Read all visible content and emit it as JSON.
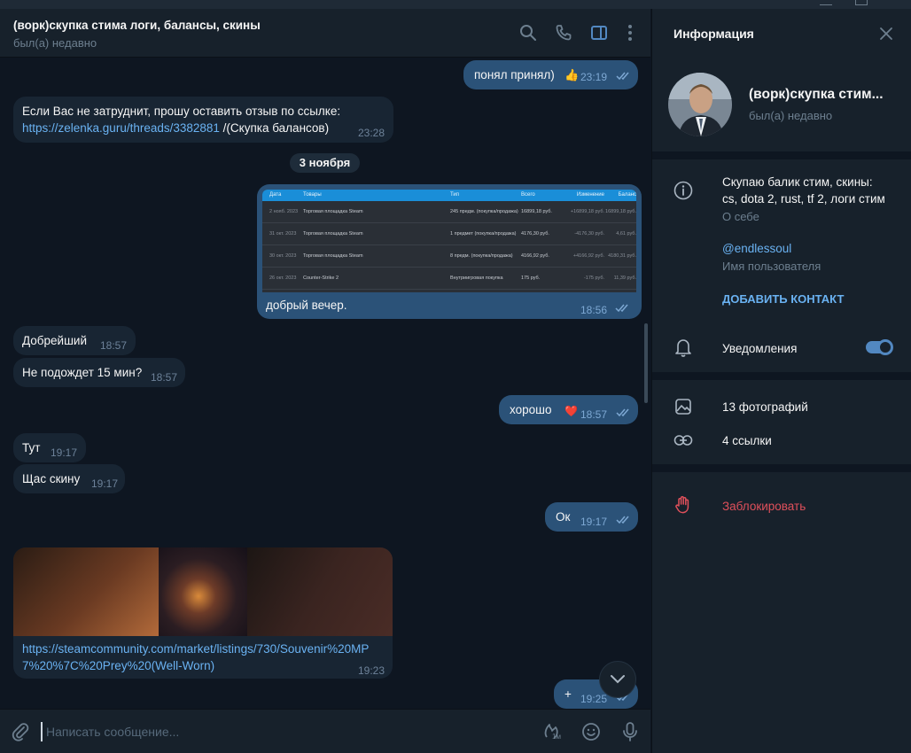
{
  "header": {
    "title": "(ворк)скупка стима логи, балансы, скины",
    "status": "был(а) недавно"
  },
  "messages": {
    "m1": {
      "text": "понял принял)",
      "reaction": "👍",
      "time": "23:19"
    },
    "m2": {
      "text_line1": "Если Вас не затруднит, прошу оставить отзыв по ссылке:",
      "link": "https://zelenka.guru/threads/3382881",
      "text_after_link": " /(Скупка балансов)",
      "time": "23:28"
    },
    "date_separator": "3 ноября",
    "m3": {
      "caption": "добрый вечер.",
      "time": "18:56",
      "screenshot": {
        "columns": [
          "Дата",
          "Товары",
          "Тип",
          "Всего",
          "Изменение",
          "Баланс"
        ],
        "rows": [
          [
            "2 нояб. 2023",
            "Торговая площадка Steam",
            "245 предм. (покупка/продажа)",
            "16899,18 руб.",
            "+16899,18 руб.",
            "16899,18 руб."
          ],
          [
            "31 окт. 2023",
            "Торговая площадка Steam",
            "1 предмет (покупка/продажа)",
            "4176,30 руб.",
            "-4176,30 руб.",
            "4,61 руб."
          ],
          [
            "30 окт. 2023",
            "Торговая площадка Steam",
            "8 предм. (покупка/продажа)",
            "4166,92 руб.",
            "+4166,92 руб.",
            "4180,31 руб."
          ],
          [
            "26 окт. 2023",
            "Counter-Strike 2",
            "Внутриигровая покупка",
            "175 руб.",
            "-175 руб.",
            "11,39 руб."
          ]
        ]
      }
    },
    "m4": {
      "text": "Добрейший",
      "time": "18:57"
    },
    "m5": {
      "text": "Не подождет 15 мин?",
      "time": "18:57"
    },
    "m6": {
      "text": "хорошо",
      "reaction": "❤️",
      "time": "18:57"
    },
    "m7": {
      "text": "Тут",
      "time": "19:17"
    },
    "m8": {
      "text": "Щас скину",
      "time": "19:17"
    },
    "m9": {
      "text": "Ок",
      "time": "19:17"
    },
    "m10": {
      "link_line1": "https://steamcommunity.com/market/listings/730/Souvenir%20MP",
      "link_line2": "7%20%7C%20Prey%20(Well-Worn)",
      "time": "19:23"
    },
    "m11": {
      "text": "+",
      "time": "19:25"
    }
  },
  "composer": {
    "placeholder": "Написать сообщение...",
    "voice_badge": "1м"
  },
  "info_panel": {
    "title": "Информация",
    "profile_name": "(ворк)скупка стим...",
    "profile_status": "был(а) недавно",
    "bio_line1": "Скупаю балик стим, скины:",
    "bio_line2": "cs, dota 2, rust, tf 2, логи стим",
    "bio_label": "О себе",
    "username": "@endlessoul",
    "username_label": "Имя пользователя",
    "add_contact": "ДОБАВИТЬ КОНТАКТ",
    "notifications": "Уведомления",
    "notifications_on": true,
    "photos": "13 фотографий",
    "links": "4 ссылки",
    "block": "Заблокировать"
  },
  "colors": {
    "accent": "#5288c1",
    "link": "#6ab2f2",
    "danger": "#e0505b",
    "out_bubble": "#2b5278",
    "in_bubble": "#182533"
  },
  "icons": [
    "search-icon",
    "phone-icon",
    "sidebar-toggle-icon",
    "more-icon",
    "close-icon",
    "info-icon",
    "bell-icon",
    "photo-icon",
    "link-icon",
    "block-hand-icon",
    "paperclip-icon",
    "sticker-icon",
    "emoji-icon",
    "microphone-icon",
    "chevron-down-icon",
    "double-check-icon"
  ]
}
